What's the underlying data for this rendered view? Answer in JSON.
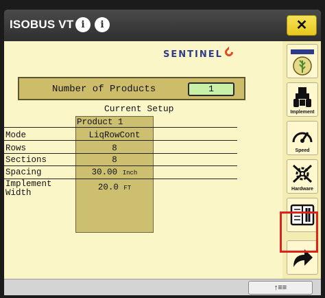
{
  "titlebar": {
    "title": "ISOBUS VT",
    "info_icon_1": "i",
    "info_icon_2": "i",
    "close_label": "✕"
  },
  "brand": {
    "logo_text": "SENTINEL"
  },
  "products": {
    "count_label": "Number of Products",
    "count_value": "1",
    "current_setup_label": "Current Setup",
    "column_header": "Product 1",
    "rows": [
      {
        "label": "Mode",
        "value": "LiqRowCont",
        "unit": ""
      },
      {
        "label": "Rows",
        "value": "8",
        "unit": ""
      },
      {
        "label": "Sections",
        "value": "8",
        "unit": ""
      },
      {
        "label": "Spacing",
        "value": "30.00",
        "unit": "Inch"
      },
      {
        "label": "Implement\nWidth",
        "value": "20.0",
        "unit": "FT"
      }
    ]
  },
  "sidebar": {
    "items": [
      {
        "name": "sentinel-crop-icon",
        "label": ""
      },
      {
        "name": "implement-icon",
        "label": "Implement"
      },
      {
        "name": "speed-icon",
        "label": "Speed"
      },
      {
        "name": "hardware-icon",
        "label": "Hardware"
      },
      {
        "name": "manual-icon",
        "label": ""
      },
      {
        "name": "next-arrow-icon",
        "label": ""
      }
    ]
  },
  "bottombar": {
    "button_label": "↑≡≡"
  }
}
